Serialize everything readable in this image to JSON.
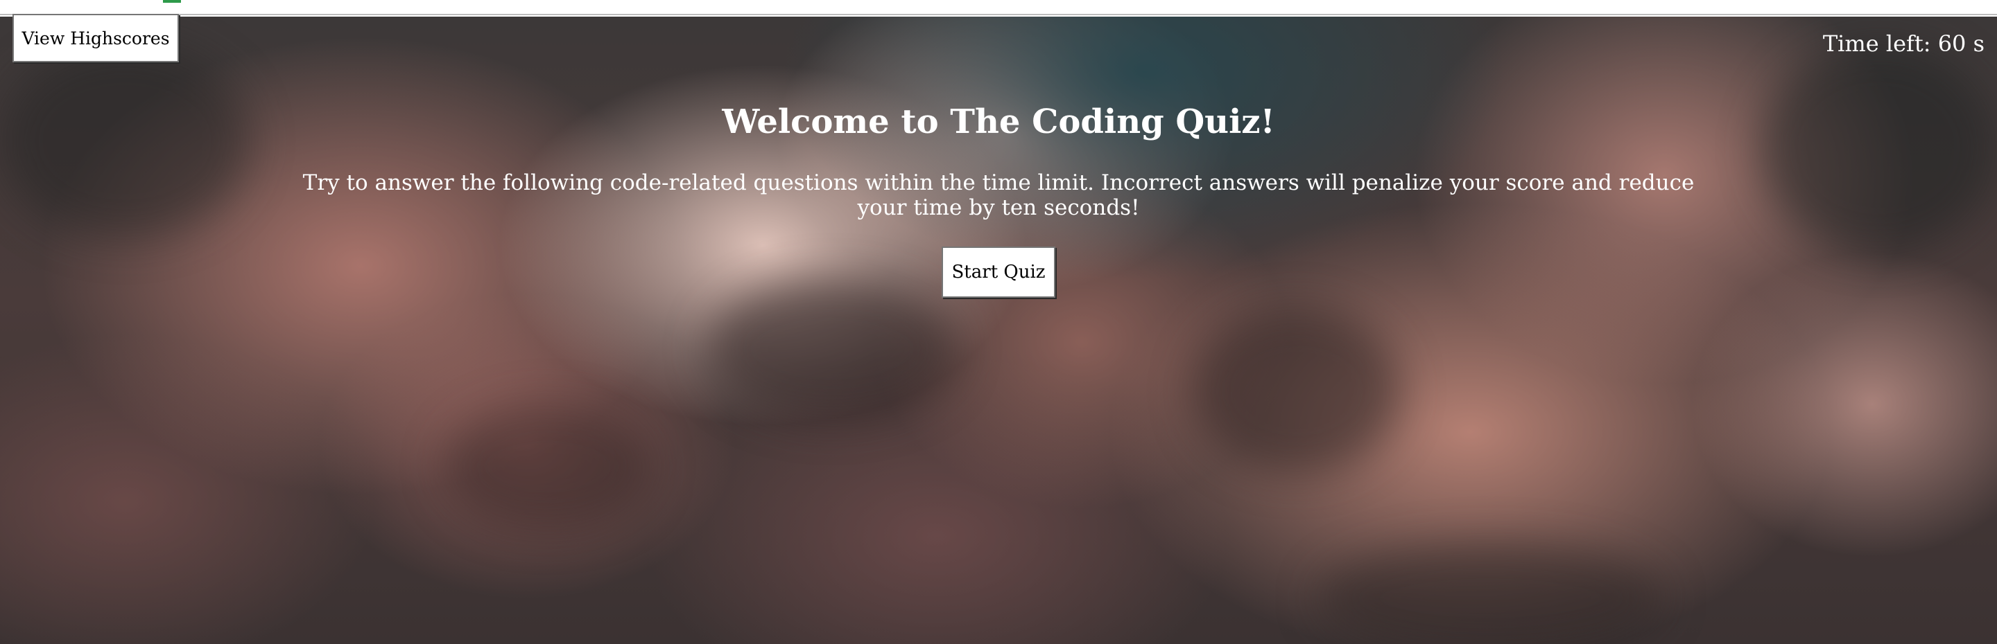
{
  "header": {
    "highscores_label": "View Highscores",
    "timer_text": "Time left: 60 s"
  },
  "main": {
    "title": "Welcome to The Coding Quiz!",
    "instructions": "Try to answer the following code-related questions within the time limit. Incorrect answers will penalize your score and reduce your time by ten seconds!",
    "start_label": "Start Quiz"
  },
  "colors": {
    "text": "#ffffff",
    "button_bg": "#ffffff",
    "button_text": "#000000",
    "background_theme": "cloudy sky, dusty pink and dark teal"
  }
}
